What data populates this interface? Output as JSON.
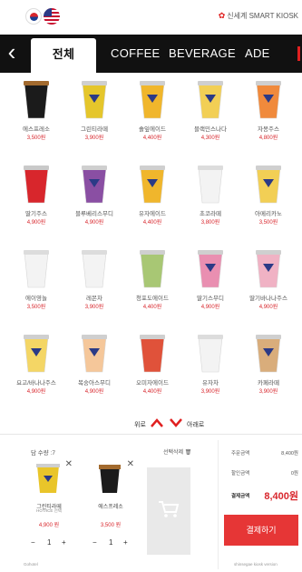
{
  "header": {
    "brand": "신세계 SMART KIOSK",
    "flag_kr_color": "#d8262c",
    "flag_us_color": "#2b3a86"
  },
  "tabs": [
    {
      "label": "전체",
      "active": true
    },
    {
      "label": "COFFEE",
      "active": false
    },
    {
      "label": "BEVERAGE",
      "active": false
    },
    {
      "label": "ADE",
      "active": false
    }
  ],
  "menu": [
    {
      "name": "에스프레소",
      "price": "3,500원",
      "cup": "espresso"
    },
    {
      "name": "그린티라떼",
      "price": "3,900원",
      "cup": "yellow-green"
    },
    {
      "name": "솔잎에이드",
      "price": "4,400원",
      "cup": "yellow-orange"
    },
    {
      "name": "블랙민스나다",
      "price": "4,300원",
      "cup": "yellow-cream"
    },
    {
      "name": "자몽주스",
      "price": "4,800원",
      "cup": "orange-red"
    },
    {
      "name": "딸기주스",
      "price": "4,900원",
      "cup": "red-berry"
    },
    {
      "name": "블루베리스무디",
      "price": "4,900원",
      "cup": "purple"
    },
    {
      "name": "유자에이드",
      "price": "4,400원",
      "cup": "yellow-orange"
    },
    {
      "name": "초코라떼",
      "price": "3,800원",
      "cup": "white"
    },
    {
      "name": "아메리카노",
      "price": "3,500원",
      "cup": "yellow-cream"
    },
    {
      "name": "에이영놀",
      "price": "3,500원",
      "cup": "white"
    },
    {
      "name": "레몬차",
      "price": "3,900원",
      "cup": "white"
    },
    {
      "name": "청포도에이드",
      "price": "4,400원",
      "cup": "green"
    },
    {
      "name": "딸기스무디",
      "price": "4,900원",
      "cup": "pink"
    },
    {
      "name": "딸기바나나주스",
      "price": "4,900원",
      "cup": "pink-yellow"
    },
    {
      "name": "요고/바나나주스",
      "price": "4,900원",
      "cup": "yellow-light"
    },
    {
      "name": "복숭아스무디",
      "price": "4,900원",
      "cup": "peach"
    },
    {
      "name": "오미자에이드",
      "price": "4,400원",
      "cup": "red-tall"
    },
    {
      "name": "유자차",
      "price": "3,900원",
      "cup": "white"
    },
    {
      "name": "카페라떼",
      "price": "3,900원",
      "cup": "latte"
    }
  ],
  "scroll": {
    "up_label": "위로",
    "down_label": "아래로"
  },
  "cart": {
    "count_label": "담 수량 :7",
    "clear_label": "선택삭제",
    "items": [
      {
        "name": "그린티라떼",
        "sub": "HOT/ICE 선택",
        "price": "4,900 원",
        "qty": "1"
      },
      {
        "name": "에스프레소",
        "price": "3,500 원",
        "qty": "1"
      }
    ]
  },
  "summary": {
    "order_label": "주문금액",
    "order_value": "8,400원",
    "discount_label": "할인금액",
    "discount_value": "0원",
    "total_label": "결제금액",
    "total_value": "8,400원",
    "pay_button": "결제하기"
  },
  "footer": {
    "left": "Gohotel",
    "right": "shinsegae kiosk version"
  }
}
